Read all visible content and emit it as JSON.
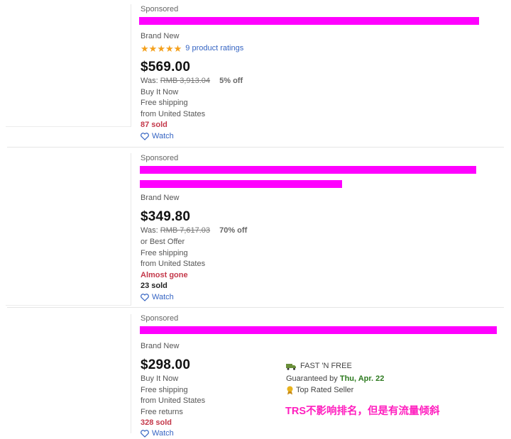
{
  "listings": [
    {
      "sponsored": "Sponsored",
      "condition": "Brand New",
      "rating_text": "9 product ratings",
      "stars": 5,
      "price": "$569.00",
      "was_label": "Was:",
      "was_price": "RMB 3,913.04",
      "discount": "5% off",
      "lines": [
        "Buy It Now",
        "Free shipping",
        "from United States"
      ],
      "sold": "87 sold",
      "watch": "Watch"
    },
    {
      "sponsored": "Sponsored",
      "condition": "Brand New",
      "price": "$349.80",
      "was_label": "Was:",
      "was_price": "RMB 7,617.03",
      "discount": "70% off",
      "lines": [
        "or Best Offer",
        "Free shipping",
        "from United States"
      ],
      "status": "Almost gone",
      "sold": "23 sold",
      "watch": "Watch"
    },
    {
      "sponsored": "Sponsored",
      "condition": "Brand New",
      "price": "$298.00",
      "lines": [
        "Buy It Now",
        "Free shipping",
        "from United States",
        "Free returns"
      ],
      "sold": "328 sold",
      "watch": "Watch",
      "fast_free": "FAST 'N FREE",
      "guaranteed_prefix": "Guaranteed by",
      "guaranteed_date": "Thu, Apr. 22",
      "top_rated": "Top Rated Seller"
    }
  ],
  "annotation": "TRS不影响排名，但是有流量倾斜",
  "colors": {
    "redaction": "#ff00ff",
    "link": "#3665c3",
    "alert": "#c4384a",
    "star": "#f4a01c",
    "annotation": "#ff1fbf"
  }
}
